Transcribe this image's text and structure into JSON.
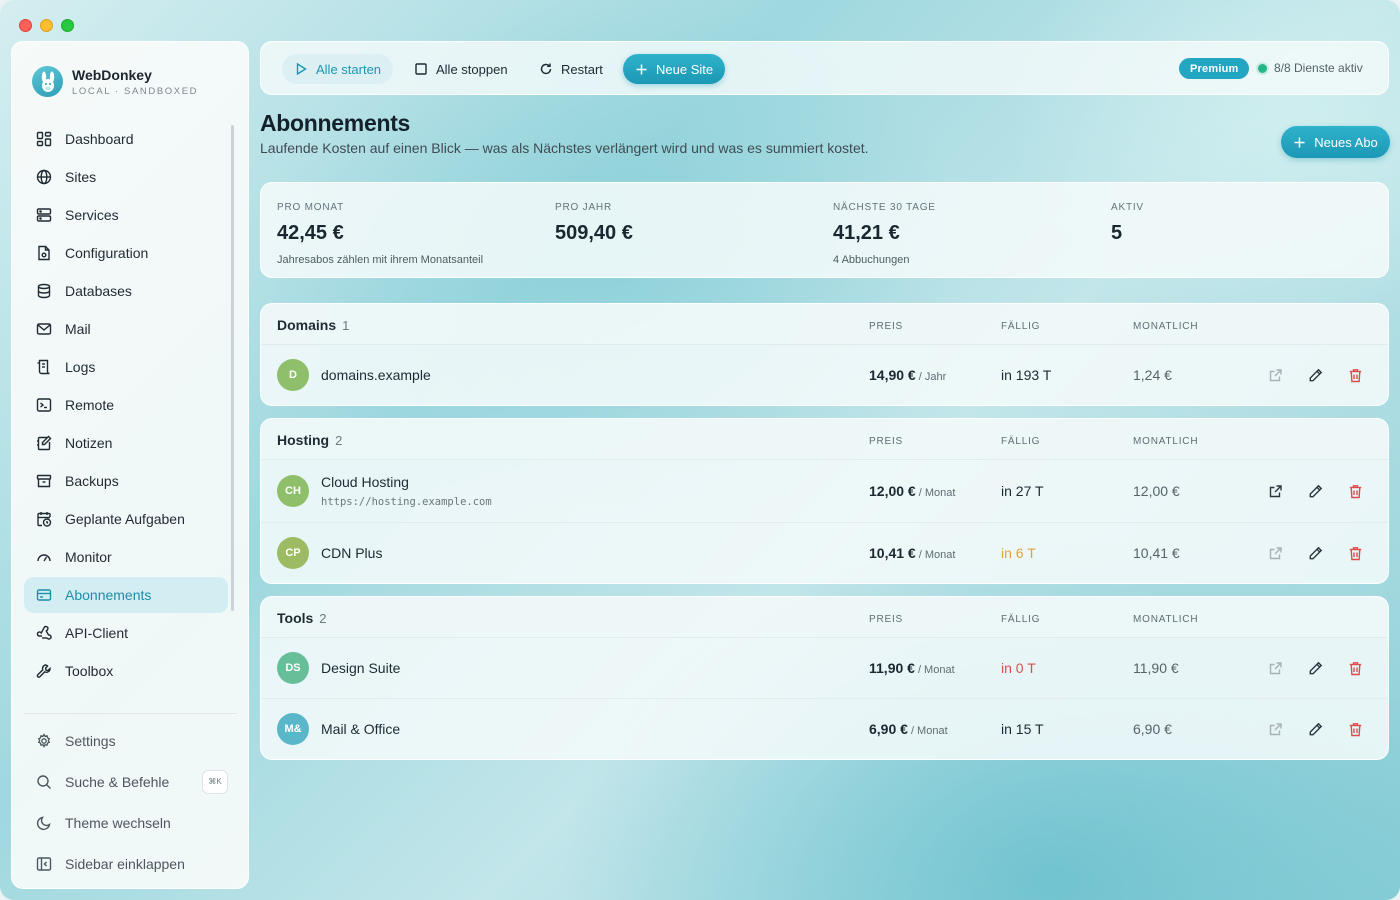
{
  "app": {
    "name": "WebDonkey",
    "subtitle": "LOCAL · SANDBOXED"
  },
  "sidebar": {
    "items": [
      {
        "label": "Dashboard",
        "icon": "dashboard-icon"
      },
      {
        "label": "Sites",
        "icon": "globe-icon"
      },
      {
        "label": "Services",
        "icon": "server-icon"
      },
      {
        "label": "Configuration",
        "icon": "config-file-icon"
      },
      {
        "label": "Databases",
        "icon": "database-icon"
      },
      {
        "label": "Mail",
        "icon": "mail-icon"
      },
      {
        "label": "Logs",
        "icon": "logs-icon"
      },
      {
        "label": "Remote",
        "icon": "terminal-icon"
      },
      {
        "label": "Notizen",
        "icon": "notes-icon"
      },
      {
        "label": "Backups",
        "icon": "archive-icon"
      },
      {
        "label": "Geplante Aufgaben",
        "icon": "calendar-clock-icon"
      },
      {
        "label": "Monitor",
        "icon": "gauge-icon"
      },
      {
        "label": "Abonnements",
        "icon": "credit-card-icon",
        "active": true
      },
      {
        "label": "API-Client",
        "icon": "webhook-icon"
      },
      {
        "label": "Toolbox",
        "icon": "wrench-icon"
      }
    ],
    "bottom": [
      {
        "label": "Settings",
        "icon": "gear-icon"
      },
      {
        "label": "Suche & Befehle",
        "icon": "search-icon",
        "shortcut": "⌘K"
      },
      {
        "label": "Theme wechseln",
        "icon": "moon-icon"
      },
      {
        "label": "Sidebar einklappen",
        "icon": "sidebar-collapse-icon"
      }
    ]
  },
  "toolbar": {
    "start_label": "Alle starten",
    "stop_label": "Alle stoppen",
    "restart_label": "Restart",
    "new_site_label": "Neue Site",
    "badge": "Premium",
    "status": "8/8 Dienste aktiv"
  },
  "header": {
    "title": "Abonnements",
    "subtitle": "Laufende Kosten auf einen Blick — was als Nächstes verlängert wird und was es summiert kostet.",
    "new_button": "Neues Abo"
  },
  "stats": [
    {
      "label": "PRO MONAT",
      "value": "42,45 €",
      "note": "Jahresabos zählen mit ihrem Monatsanteil"
    },
    {
      "label": "PRO JAHR",
      "value": "509,40 €",
      "note": ""
    },
    {
      "label": "NÄCHSTE 30 TAGE",
      "value": "41,21 €",
      "note": "4 Abbuchungen"
    },
    {
      "label": "AKTIV",
      "value": "5",
      "note": ""
    }
  ],
  "columns": {
    "price": "PREIS",
    "due": "FÄLLIG",
    "monthly": "MONATLICH"
  },
  "groups": [
    {
      "name": "Domains",
      "count": "1",
      "rows": [
        {
          "initials": "D",
          "color": "#8fbf6a",
          "name": "domains.example",
          "url": "",
          "price": "14,90 €",
          "unit": "/ Jahr",
          "due": "in 193 T",
          "due_state": "normal",
          "monthly": "1,24 €"
        }
      ]
    },
    {
      "name": "Hosting",
      "count": "2",
      "rows": [
        {
          "initials": "CH",
          "color": "#8fbf6a",
          "name": "Cloud Hosting",
          "url": "https://hosting.example.com",
          "price": "12,00 €",
          "unit": "/ Monat",
          "due": "in 27 T",
          "due_state": "normal",
          "monthly": "12,00 €"
        },
        {
          "initials": "CP",
          "color": "#9dbb63",
          "name": "CDN Plus",
          "url": "",
          "price": "10,41 €",
          "unit": "/ Monat",
          "due": "in 6 T",
          "due_state": "warn",
          "monthly": "10,41 €"
        }
      ]
    },
    {
      "name": "Tools",
      "count": "2",
      "rows": [
        {
          "initials": "DS",
          "color": "#66bf98",
          "name": "Design Suite",
          "url": "",
          "price": "11,90 €",
          "unit": "/ Monat",
          "due": "in 0 T",
          "due_state": "danger",
          "monthly": "11,90 €"
        },
        {
          "initials": "M&",
          "color": "#5ab7c9",
          "name": "Mail & Office",
          "url": "",
          "price": "6,90 €",
          "unit": "/ Monat",
          "due": "in 15 T",
          "due_state": "normal",
          "monthly": "6,90 €"
        }
      ]
    }
  ],
  "colors": {
    "accent": "#1f95b0",
    "danger": "#e14a4a",
    "warn": "#e0a33b",
    "ok": "#26b58a"
  }
}
